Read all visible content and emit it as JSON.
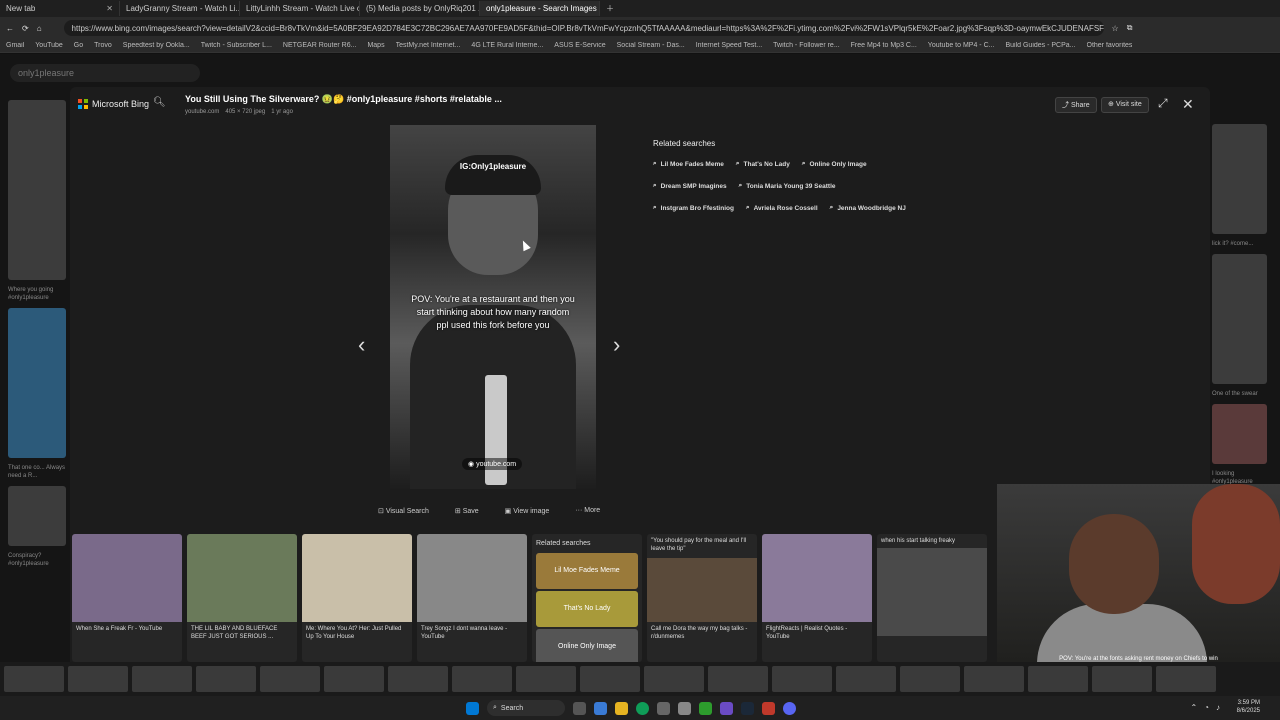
{
  "tabs": [
    {
      "label": "New tab"
    },
    {
      "label": "LadyGranny Stream - Watch Li..."
    },
    {
      "label": "LittyLinhh Stream - Watch Live on..."
    },
    {
      "label": "(5) Media posts by OnlyRiq201 ..."
    },
    {
      "label": "only1pleasure - Search Images"
    }
  ],
  "address": {
    "url": "https://www.bing.com/images/search?view=detailV2&ccid=Br8vTkVm&id=5A0BF29EA92D784E3C72BC296AE7AA970FE9AD5F&thid=OIP.Br8vTkVmFwYcpznhQ5TfAAAAA&mediaurl=https%3A%2F%2Fi.ytimg.com%2Fvi%2FW1sVPlqr5kE%2Foar2.jpg%3Fsqp%3D-oaymwEkCJUDENAFSFqQAgHyq4qpAxMIARUAAAAAJQAAyF..."
  },
  "bookmarks": [
    "Gmail",
    "YouTube",
    "Go",
    "Trovo",
    "Speedtest by Ookla...",
    "Twitch - Subscriber L...",
    "NETGEAR Router R6...",
    "Maps",
    "TestMy.net Internet...",
    "4G LTE Rural Interne...",
    "ASUS E-Service",
    "Social Stream - Das...",
    "Internet Speed Test...",
    "Twitch - Follower re...",
    "Free Mp4 to Mp3 C...",
    "Youtube to MP4 - C...",
    "Build Guides - PCPa...",
    "Other favorites"
  ],
  "background": {
    "search_value": "only1pleasure",
    "left_captions": [
      "Where you going #only1pleasure",
      "That one co... Always need a R...",
      "Conspiracy? #only1pleasure"
    ],
    "right_captions": [
      "lick it? #come...",
      "One of the swear",
      "I looking #only1pleasure"
    ]
  },
  "modal": {
    "brand": "Microsoft Bing",
    "title": "You Still Using The Silverware? 🤢🤔 #only1pleasure #shorts #relatable ...",
    "meta_source": "youtube.com",
    "meta_size": "405 × 720 jpeg",
    "meta_age": "1 yr ago",
    "share_label": "Share",
    "visit_label": "Visit site",
    "hero_top_text": "IG:Only1pleasure",
    "hero_caption": "POV: You're at a restaurant and then you start thinking about how many random ppl used this fork before you",
    "hero_source": "youtube.com",
    "related_title": "Related searches",
    "related": [
      "Lil Moe Fades Meme",
      "That's No Lady",
      "Online Only Image",
      "Dream SMP Imagines",
      "Tonia Maria Young 39 Seattle",
      "Instgram Bro Ffestiniog",
      "Avriela Rose Cossell",
      "Jenna Woodbridge NJ"
    ],
    "actions": [
      "Visual Search",
      "Save",
      "View image",
      "More"
    ]
  },
  "grid": {
    "cards": [
      {
        "caption": "When She a Freak Fr - YouTube",
        "color": "#7a6a8a"
      },
      {
        "caption": "THE LIL BABY AND BLUEFACE BEEF JUST GOT SERIOUS ...",
        "color": "#6a7a5a"
      },
      {
        "caption": "Me: Where You At? Her: Just Pulled Up To Your House",
        "color": "#c9bfa9"
      },
      {
        "caption": "Trey Songz I dont wanna leave - YouTube",
        "color": "#888888"
      },
      {
        "caption": "Call me Dora the way my bag talks - r/dunmemes",
        "color": "#5a4a3a"
      },
      {
        "caption": "FlightReacts | Realist Quotes - YouTube",
        "color": "#8a7a9a"
      },
      {
        "caption": "when his start talking freaky",
        "color": "#4a4a4a"
      }
    ],
    "related_card_title": "Related searches",
    "related_card_items": [
      "Lil Moe Fades Meme",
      "That's No Lady",
      "Online Only Image"
    ],
    "quote_text": "\"You should pay for the meal and I'll leave the tip\""
  },
  "webcam": {
    "overlay": "POV: You're at the fonts asking rent money on Chiefs to win"
  },
  "taskbar": {
    "search_label": "Search",
    "time": "3:59 PM",
    "date": "8/6/2025"
  },
  "colors": {
    "accent": "#0067b8",
    "bing_red": "#f25022",
    "bing_green": "#7fba00",
    "bing_blue": "#00a4ef",
    "bing_yellow": "#ffb900"
  }
}
